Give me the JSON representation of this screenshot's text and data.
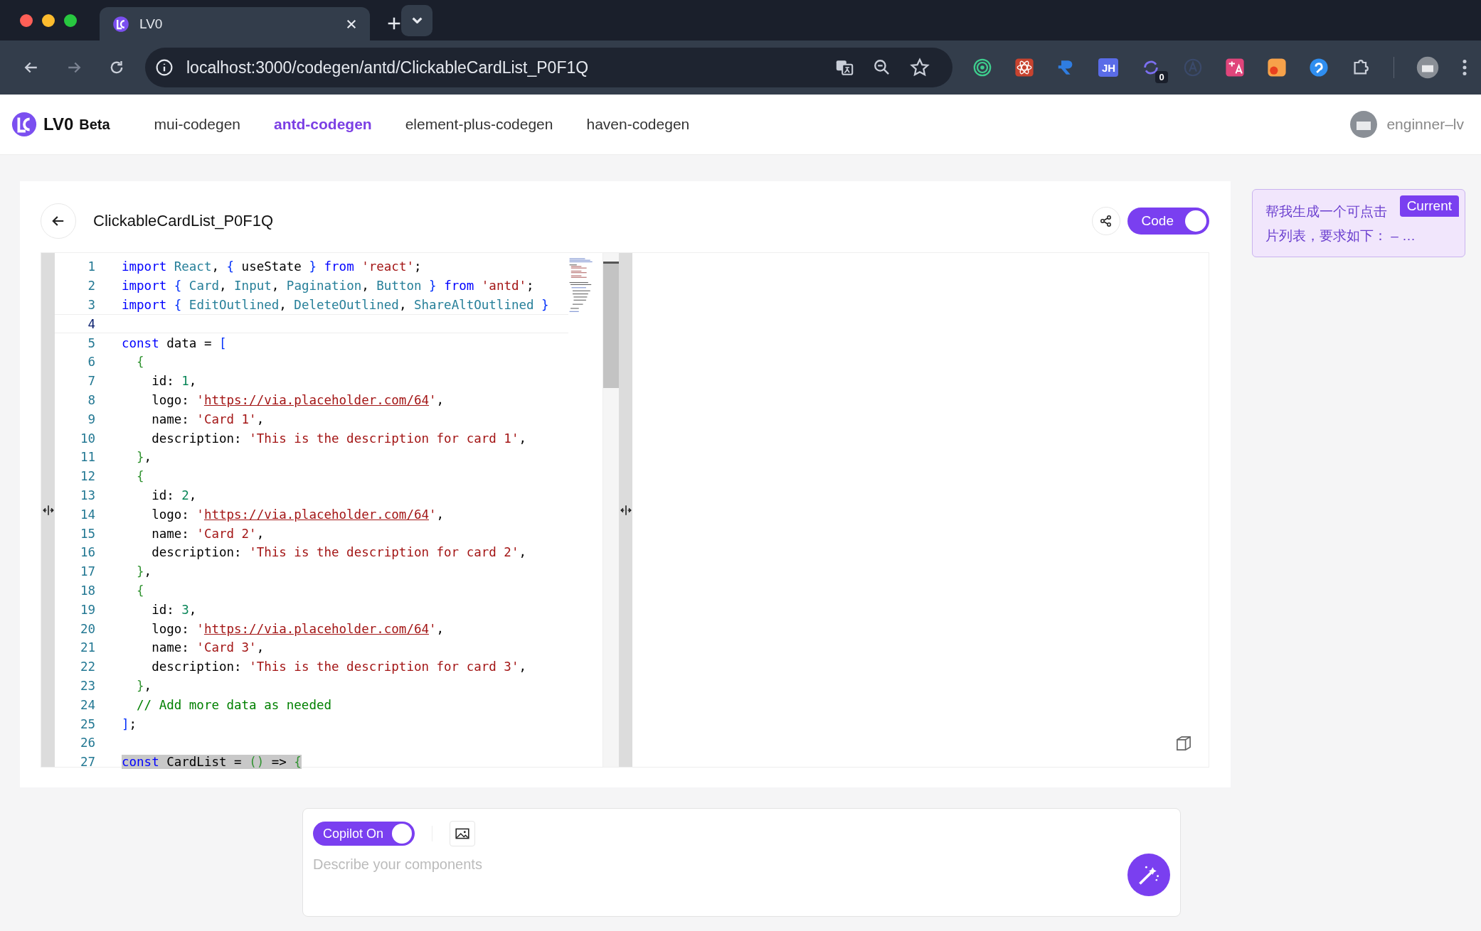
{
  "browser": {
    "tabs": [
      {
        "title": "LV0",
        "selected": true
      }
    ],
    "address": "localhost:3000/codegen/antd/ClickableCardList_P0F1Q",
    "extension_label": "JH",
    "extension_badge": "0"
  },
  "app": {
    "logo": "LV0",
    "badge": "Beta",
    "nav": [
      {
        "label": "mui-codegen",
        "selected": false
      },
      {
        "label": "antd-codegen",
        "selected": true
      },
      {
        "label": "element-plus-codegen",
        "selected": false
      },
      {
        "label": "haven-codegen",
        "selected": false
      }
    ],
    "user": "enginner–lv"
  },
  "editor": {
    "title": "ClickableCardList_P0F1Q",
    "code_toggle": {
      "label": "Code",
      "on": true
    },
    "lines": [
      {
        "number": "1",
        "current": false,
        "selected": false,
        "tokens": [
          {
            "kind": "keyword",
            "text": "import "
          },
          {
            "kind": "type",
            "text": "React"
          },
          {
            "kind": "plain",
            "text": ", "
          },
          {
            "kind": "bracket1",
            "text": "{"
          },
          {
            "kind": "plain",
            "text": " useState "
          },
          {
            "kind": "bracket1",
            "text": "}"
          },
          {
            "kind": "keyword",
            "text": " from "
          },
          {
            "kind": "string",
            "text": "'react'"
          },
          {
            "kind": "plain",
            "text": ";"
          }
        ]
      },
      {
        "number": "2",
        "current": false,
        "selected": false,
        "tokens": [
          {
            "kind": "keyword",
            "text": "import "
          },
          {
            "kind": "bracket1",
            "text": "{"
          },
          {
            "kind": "type",
            "text": " Card"
          },
          {
            "kind": "plain",
            "text": ", "
          },
          {
            "kind": "type",
            "text": "Input"
          },
          {
            "kind": "plain",
            "text": ", "
          },
          {
            "kind": "type",
            "text": "Pagination"
          },
          {
            "kind": "plain",
            "text": ", "
          },
          {
            "kind": "type",
            "text": "Button "
          },
          {
            "kind": "bracket1",
            "text": "}"
          },
          {
            "kind": "keyword",
            "text": " from "
          },
          {
            "kind": "string",
            "text": "'antd'"
          },
          {
            "kind": "plain",
            "text": ";"
          }
        ]
      },
      {
        "number": "3",
        "current": false,
        "selected": false,
        "tokens": [
          {
            "kind": "keyword",
            "text": "import "
          },
          {
            "kind": "bracket1",
            "text": "{"
          },
          {
            "kind": "type",
            "text": " EditOutlined"
          },
          {
            "kind": "plain",
            "text": ", "
          },
          {
            "kind": "type",
            "text": "DeleteOutlined"
          },
          {
            "kind": "plain",
            "text": ", "
          },
          {
            "kind": "type",
            "text": "ShareAltOutlined "
          },
          {
            "kind": "bracket1",
            "text": "}"
          }
        ]
      },
      {
        "number": "4",
        "current": true,
        "selected": false
      },
      {
        "number": "5",
        "current": false,
        "selected": false,
        "tokens": [
          {
            "kind": "keyword",
            "text": "const "
          },
          {
            "kind": "plain",
            "text": "data = "
          },
          {
            "kind": "bracket1",
            "text": "["
          }
        ]
      },
      {
        "number": "6",
        "current": false,
        "selected": false,
        "tokens": [
          {
            "kind": "bracket2",
            "text": "  {"
          }
        ]
      },
      {
        "number": "7",
        "current": false,
        "selected": false,
        "tokens": [
          {
            "kind": "plain",
            "text": "    id: "
          },
          {
            "kind": "number",
            "text": "1"
          },
          {
            "kind": "plain",
            "text": ","
          }
        ]
      },
      {
        "number": "8",
        "current": false,
        "selected": false,
        "tokens": [
          {
            "kind": "plain",
            "text": "    logo: "
          },
          {
            "kind": "string",
            "text": "'"
          },
          {
            "kind": "url",
            "text": "https://via.placeholder.com/64"
          },
          {
            "kind": "string",
            "text": "'"
          },
          {
            "kind": "plain",
            "text": ","
          }
        ]
      },
      {
        "number": "9",
        "current": false,
        "selected": false,
        "tokens": [
          {
            "kind": "plain",
            "text": "    name: "
          },
          {
            "kind": "string",
            "text": "'Card 1'"
          },
          {
            "kind": "plain",
            "text": ","
          }
        ]
      },
      {
        "number": "10",
        "current": false,
        "selected": false,
        "tokens": [
          {
            "kind": "plain",
            "text": "    description: "
          },
          {
            "kind": "string",
            "text": "'This is the description for card 1'"
          },
          {
            "kind": "plain",
            "text": ","
          }
        ]
      },
      {
        "number": "11",
        "current": false,
        "selected": false,
        "tokens": [
          {
            "kind": "bracket2",
            "text": "  }"
          },
          {
            "kind": "plain",
            "text": ","
          }
        ]
      },
      {
        "number": "12",
        "current": false,
        "selected": false,
        "tokens": [
          {
            "kind": "bracket2",
            "text": "  {"
          }
        ]
      },
      {
        "number": "13",
        "current": false,
        "selected": false,
        "tokens": [
          {
            "kind": "plain",
            "text": "    id: "
          },
          {
            "kind": "number",
            "text": "2"
          },
          {
            "kind": "plain",
            "text": ","
          }
        ]
      },
      {
        "number": "14",
        "current": false,
        "selected": false,
        "tokens": [
          {
            "kind": "plain",
            "text": "    logo: "
          },
          {
            "kind": "string",
            "text": "'"
          },
          {
            "kind": "url",
            "text": "https://via.placeholder.com/64"
          },
          {
            "kind": "string",
            "text": "'"
          },
          {
            "kind": "plain",
            "text": ","
          }
        ]
      },
      {
        "number": "15",
        "current": false,
        "selected": false,
        "tokens": [
          {
            "kind": "plain",
            "text": "    name: "
          },
          {
            "kind": "string",
            "text": "'Card 2'"
          },
          {
            "kind": "plain",
            "text": ","
          }
        ]
      },
      {
        "number": "16",
        "current": false,
        "selected": false,
        "tokens": [
          {
            "kind": "plain",
            "text": "    description: "
          },
          {
            "kind": "string",
            "text": "'This is the description for card 2'"
          },
          {
            "kind": "plain",
            "text": ","
          }
        ]
      },
      {
        "number": "17",
        "current": false,
        "selected": false,
        "tokens": [
          {
            "kind": "bracket2",
            "text": "  }"
          },
          {
            "kind": "plain",
            "text": ","
          }
        ]
      },
      {
        "number": "18",
        "current": false,
        "selected": false,
        "tokens": [
          {
            "kind": "bracket2",
            "text": "  {"
          }
        ]
      },
      {
        "number": "19",
        "current": false,
        "selected": false,
        "tokens": [
          {
            "kind": "plain",
            "text": "    id: "
          },
          {
            "kind": "number",
            "text": "3"
          },
          {
            "kind": "plain",
            "text": ","
          }
        ]
      },
      {
        "number": "20",
        "current": false,
        "selected": false,
        "tokens": [
          {
            "kind": "plain",
            "text": "    logo: "
          },
          {
            "kind": "string",
            "text": "'"
          },
          {
            "kind": "url",
            "text": "https://via.placeholder.com/64"
          },
          {
            "kind": "string",
            "text": "'"
          },
          {
            "kind": "plain",
            "text": ","
          }
        ]
      },
      {
        "number": "21",
        "current": false,
        "selected": false,
        "tokens": [
          {
            "kind": "plain",
            "text": "    name: "
          },
          {
            "kind": "string",
            "text": "'Card 3'"
          },
          {
            "kind": "plain",
            "text": ","
          }
        ]
      },
      {
        "number": "22",
        "current": false,
        "selected": false,
        "tokens": [
          {
            "kind": "plain",
            "text": "    description: "
          },
          {
            "kind": "string",
            "text": "'This is the description for card 3'"
          },
          {
            "kind": "plain",
            "text": ","
          }
        ]
      },
      {
        "number": "23",
        "current": false,
        "selected": false,
        "tokens": [
          {
            "kind": "bracket2",
            "text": "  }"
          },
          {
            "kind": "plain",
            "text": ","
          }
        ]
      },
      {
        "number": "24",
        "current": false,
        "selected": false,
        "tokens": [
          {
            "kind": "comment",
            "text": "  // Add more data as needed"
          }
        ]
      },
      {
        "number": "25",
        "current": false,
        "selected": false,
        "tokens": [
          {
            "kind": "bracket1",
            "text": "]"
          },
          {
            "kind": "plain",
            "text": ";"
          }
        ]
      },
      {
        "number": "26",
        "current": false,
        "selected": false
      },
      {
        "number": "27",
        "current": false,
        "selected": true,
        "tokens": [
          {
            "kind": "keyword",
            "text": "const "
          },
          {
            "kind": "plain",
            "text": "CardList = "
          },
          {
            "kind": "bracket2",
            "text": "()"
          },
          {
            "kind": "plain",
            "text": " => "
          },
          {
            "kind": "bracket2",
            "text": "{"
          }
        ]
      }
    ]
  },
  "history": [
    {
      "lines": [
        "帮我生成一个可点击",
        "片列表，要求如下： – …"
      ],
      "tag": "Current"
    }
  ],
  "composer": {
    "copilot": {
      "label": "Copilot On",
      "on": true
    },
    "placeholder": "Describe your components"
  }
}
